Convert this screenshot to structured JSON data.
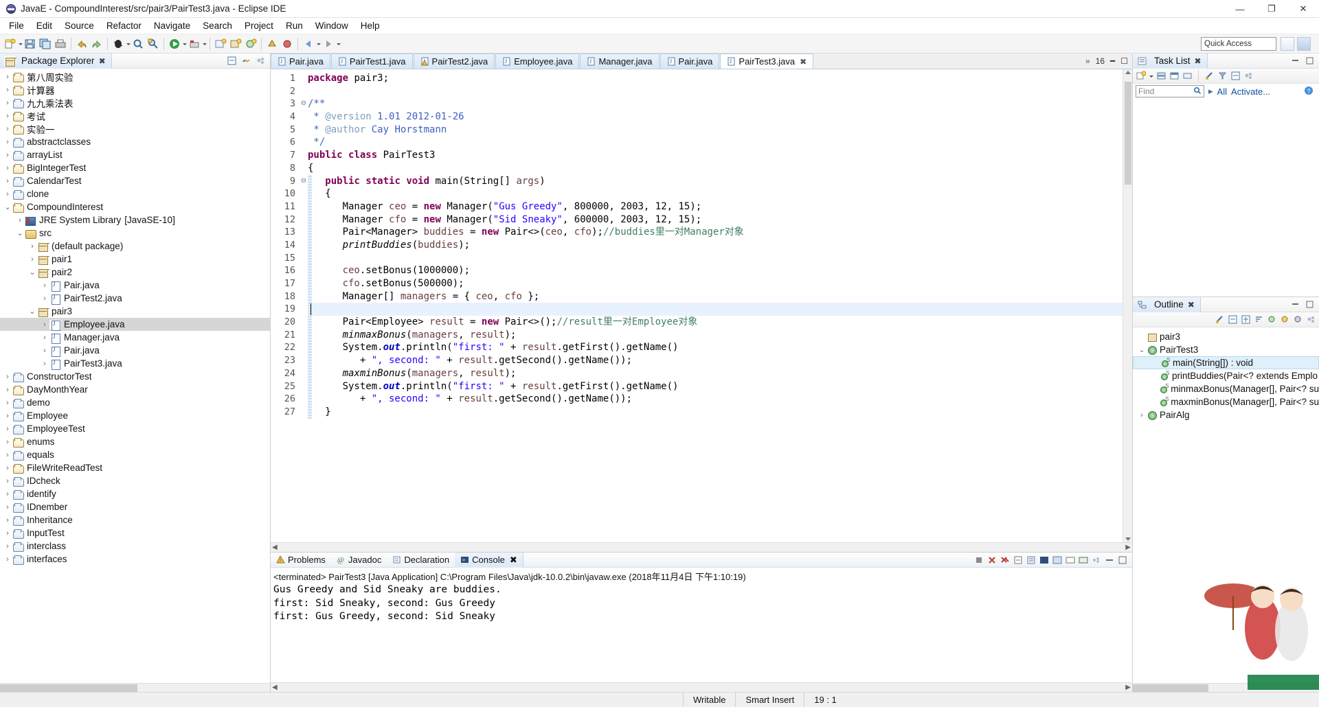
{
  "window": {
    "title": "JavaE - CompoundInterest/src/pair3/PairTest3.java - Eclipse IDE",
    "minimize": "—",
    "maximize": "❐",
    "close": "✕"
  },
  "menubar": [
    "File",
    "Edit",
    "Source",
    "Refactor",
    "Navigate",
    "Search",
    "Project",
    "Run",
    "Window",
    "Help"
  ],
  "toolbar": {
    "quick_access_placeholder": "Quick Access"
  },
  "package_explorer": {
    "title": "Package Explorer",
    "close_label": "✖",
    "items": [
      {
        "label": "第八周实验",
        "indent": 0,
        "arrow": "›",
        "icon": "project-java-icon"
      },
      {
        "label": "计算器",
        "indent": 0,
        "arrow": "›",
        "icon": "project-java-icon"
      },
      {
        "label": "九九乘法表",
        "indent": 0,
        "arrow": "›",
        "icon": "project-icon"
      },
      {
        "label": "考试",
        "indent": 0,
        "arrow": "›",
        "icon": "project-java-icon"
      },
      {
        "label": "实验一",
        "indent": 0,
        "arrow": "›",
        "icon": "project-java-icon"
      },
      {
        "label": "abstractclasses",
        "indent": 0,
        "arrow": "›",
        "icon": "project-icon"
      },
      {
        "label": "arrayList",
        "indent": 0,
        "arrow": "›",
        "icon": "project-icon"
      },
      {
        "label": "BigIntegerTest",
        "indent": 0,
        "arrow": "›",
        "icon": "project-java-icon"
      },
      {
        "label": "CalendarTest",
        "indent": 0,
        "arrow": "›",
        "icon": "project-icon"
      },
      {
        "label": "clone",
        "indent": 0,
        "arrow": "›",
        "icon": "project-icon"
      },
      {
        "label": "CompoundInterest",
        "indent": 0,
        "arrow": "⌄",
        "icon": "project-java-icon"
      },
      {
        "label": "JRE System Library",
        "suffix": "[JavaSE-10]",
        "indent": 1,
        "arrow": "›",
        "icon": "library-icon"
      },
      {
        "label": "src",
        "indent": 1,
        "arrow": "⌄",
        "icon": "source-folder-icon"
      },
      {
        "label": "(default package)",
        "indent": 2,
        "arrow": "›",
        "icon": "package-icon"
      },
      {
        "label": "pair1",
        "indent": 2,
        "arrow": "›",
        "icon": "package-icon"
      },
      {
        "label": "pair2",
        "indent": 2,
        "arrow": "⌄",
        "icon": "package-icon"
      },
      {
        "label": "Pair.java",
        "indent": 3,
        "arrow": "›",
        "icon": "java-file-icon"
      },
      {
        "label": "PairTest2.java",
        "indent": 3,
        "arrow": "›",
        "icon": "java-file-icon"
      },
      {
        "label": "pair3",
        "indent": 2,
        "arrow": "⌄",
        "icon": "package-icon"
      },
      {
        "label": "Employee.java",
        "indent": 3,
        "arrow": "›",
        "icon": "java-file-icon",
        "selected": true
      },
      {
        "label": "Manager.java",
        "indent": 3,
        "arrow": "›",
        "icon": "java-file-icon"
      },
      {
        "label": "Pair.java",
        "indent": 3,
        "arrow": "›",
        "icon": "java-file-icon"
      },
      {
        "label": "PairTest3.java",
        "indent": 3,
        "arrow": "›",
        "icon": "java-file-icon"
      },
      {
        "label": "ConstructorTest",
        "indent": 0,
        "arrow": "›",
        "icon": "project-icon"
      },
      {
        "label": "DayMonthYear",
        "indent": 0,
        "arrow": "›",
        "icon": "project-java-icon"
      },
      {
        "label": "demo",
        "indent": 0,
        "arrow": "›",
        "icon": "project-icon"
      },
      {
        "label": "Employee",
        "indent": 0,
        "arrow": "›",
        "icon": "project-icon"
      },
      {
        "label": "EmployeeTest",
        "indent": 0,
        "arrow": "›",
        "icon": "project-icon"
      },
      {
        "label": "enums",
        "indent": 0,
        "arrow": "›",
        "icon": "project-java-icon"
      },
      {
        "label": "equals",
        "indent": 0,
        "arrow": "›",
        "icon": "project-icon"
      },
      {
        "label": "FileWriteReadTest",
        "indent": 0,
        "arrow": "›",
        "icon": "project-java-icon"
      },
      {
        "label": "IDcheck",
        "indent": 0,
        "arrow": "›",
        "icon": "project-icon"
      },
      {
        "label": "identify",
        "indent": 0,
        "arrow": "›",
        "icon": "project-icon"
      },
      {
        "label": "IDnember",
        "indent": 0,
        "arrow": "›",
        "icon": "project-icon"
      },
      {
        "label": "Inheritance",
        "indent": 0,
        "arrow": "›",
        "icon": "project-icon"
      },
      {
        "label": "InputTest",
        "indent": 0,
        "arrow": "›",
        "icon": "project-icon"
      },
      {
        "label": "interclass",
        "indent": 0,
        "arrow": "›",
        "icon": "project-icon"
      },
      {
        "label": "interfaces",
        "indent": 0,
        "arrow": "›",
        "icon": "project-icon"
      }
    ]
  },
  "editor": {
    "tabs": [
      {
        "label": "Pair.java",
        "active": false,
        "warning": false
      },
      {
        "label": "PairTest1.java",
        "active": false,
        "warning": false
      },
      {
        "label": "PairTest2.java",
        "active": false,
        "warning": true
      },
      {
        "label": "Employee.java",
        "active": false,
        "warning": false
      },
      {
        "label": "Manager.java",
        "active": false,
        "warning": false
      },
      {
        "label": "Pair.java",
        "active": false,
        "warning": false
      },
      {
        "label": "PairTest3.java",
        "active": true,
        "warning": false
      }
    ],
    "overflow_count": "16",
    "lines": [
      {
        "n": 1,
        "fold": ""
      },
      {
        "n": 2,
        "fold": ""
      },
      {
        "n": 3,
        "fold": "⊖"
      },
      {
        "n": 4,
        "fold": ""
      },
      {
        "n": 5,
        "fold": ""
      },
      {
        "n": 6,
        "fold": ""
      },
      {
        "n": 7,
        "fold": ""
      },
      {
        "n": 8,
        "fold": ""
      },
      {
        "n": 9,
        "fold": "⊖"
      },
      {
        "n": 10,
        "fold": ""
      },
      {
        "n": 11,
        "fold": ""
      },
      {
        "n": 12,
        "fold": ""
      },
      {
        "n": 13,
        "fold": ""
      },
      {
        "n": 14,
        "fold": ""
      },
      {
        "n": 15,
        "fold": ""
      },
      {
        "n": 16,
        "fold": ""
      },
      {
        "n": 17,
        "fold": ""
      },
      {
        "n": 18,
        "fold": ""
      },
      {
        "n": 19,
        "fold": ""
      },
      {
        "n": 20,
        "fold": ""
      },
      {
        "n": 21,
        "fold": ""
      },
      {
        "n": 22,
        "fold": ""
      },
      {
        "n": 23,
        "fold": ""
      },
      {
        "n": 24,
        "fold": ""
      },
      {
        "n": 25,
        "fold": ""
      },
      {
        "n": 26,
        "fold": ""
      },
      {
        "n": 27,
        "fold": ""
      }
    ],
    "source_text": "package pair3;\n\n/**\n * @version 1.01 2012-01-26\n * @author Cay Horstmann\n */\npublic class PairTest3\n{\n   public static void main(String[] args)\n   {\n      Manager ceo = new Manager(\"Gus Greedy\", 800000, 2003, 12, 15);\n      Manager cfo = new Manager(\"Sid Sneaky\", 600000, 2003, 12, 15);\n      Pair<Manager> buddies = new Pair<>(ceo, cfo);//buddies里一对Manager对象\n      printBuddies(buddies);\n\n      ceo.setBonus(1000000);\n      cfo.setBonus(500000);\n      Manager[] managers = { ceo, cfo };\n\n      Pair<Employee> result = new Pair<>();//result里一对Employee对象\n      minmaxBonus(managers, result);\n      System.out.println(\"first: \" + result.getFirst().getName()\n         + \", second: \" + result.getSecond().getName());\n      maxminBonus(managers, result);\n      System.out.println(\"first: \" + result.getFirst().getName()\n         + \", second: \" + result.getSecond().getName());\n   }"
  },
  "console": {
    "tabs": [
      {
        "label": "Problems",
        "active": false,
        "icon": "problems-icon"
      },
      {
        "label": "Javadoc",
        "active": false,
        "icon": "javadoc-icon"
      },
      {
        "label": "Declaration",
        "active": false,
        "icon": "declaration-icon"
      },
      {
        "label": "Console",
        "active": true,
        "icon": "console-icon"
      }
    ],
    "close_label": "✖",
    "launch_info": "<terminated> PairTest3 [Java Application] C:\\Program Files\\Java\\jdk-10.0.2\\bin\\javaw.exe (2018年11月4日 下午1:10:19)",
    "output": "Gus Greedy and Sid Sneaky are buddies.\nfirst: Sid Sneaky, second: Gus Greedy\nfirst: Gus Greedy, second: Sid Sneaky"
  },
  "task_list": {
    "title": "Task List",
    "close_label": "✖",
    "find_placeholder": "Find",
    "all_label": "All",
    "activate_label": "Activate..."
  },
  "outline": {
    "title": "Outline",
    "close_label": "✖",
    "items": [
      {
        "label": "pair3",
        "indent": 0,
        "arrow": "",
        "icon": "package-icon",
        "selected": false
      },
      {
        "label": "PairTest3",
        "indent": 0,
        "arrow": "⌄",
        "icon": "class-icon",
        "selected": false
      },
      {
        "label": "main(String[]) : void",
        "indent": 1,
        "arrow": "",
        "icon": "method-public-icon",
        "selected": true
      },
      {
        "label": "printBuddies(Pair<? extends Emplo",
        "indent": 1,
        "arrow": "",
        "icon": "method-public-icon",
        "selected": false
      },
      {
        "label": "minmaxBonus(Manager[], Pair<? su",
        "indent": 1,
        "arrow": "",
        "icon": "method-public-icon",
        "selected": false
      },
      {
        "label": "maxminBonus(Manager[], Pair<? su",
        "indent": 1,
        "arrow": "",
        "icon": "method-public-icon",
        "selected": false
      },
      {
        "label": "PairAlg",
        "indent": 0,
        "arrow": "›",
        "icon": "class-icon",
        "selected": false
      }
    ]
  },
  "status_bar": {
    "writable": "Writable",
    "insert_mode": "Smart Insert",
    "position": "19 : 1"
  }
}
